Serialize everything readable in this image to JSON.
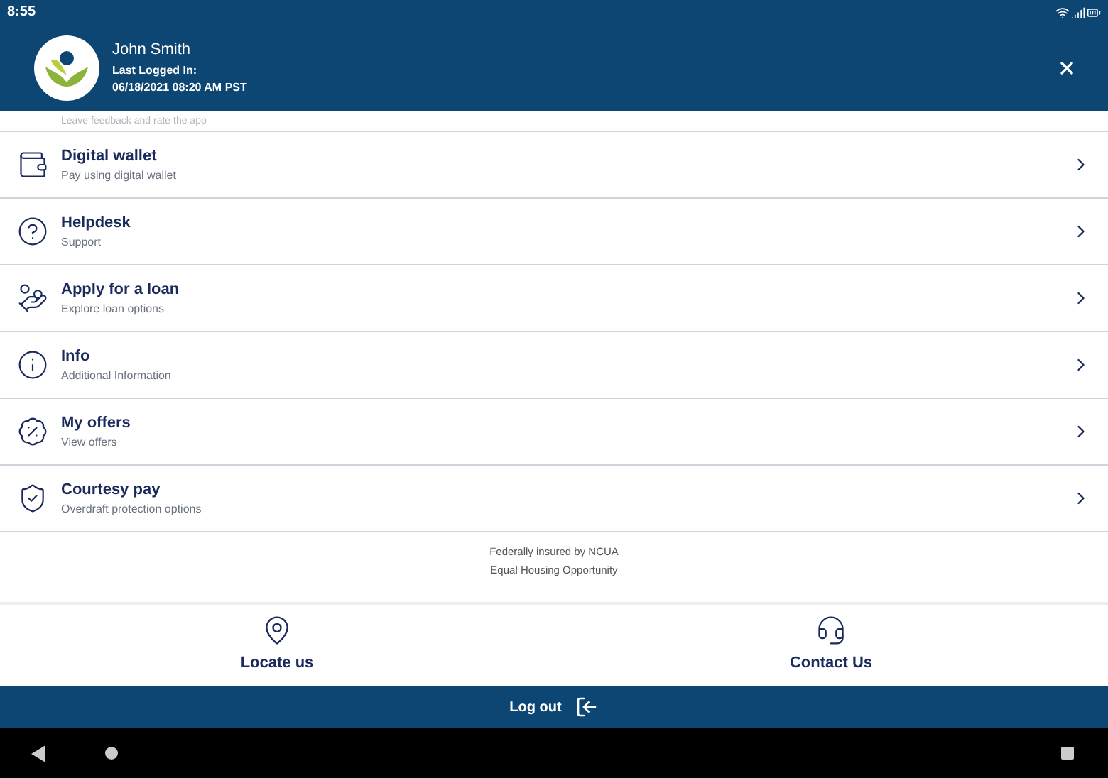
{
  "status_bar": {
    "time": "8:55"
  },
  "header": {
    "name": "John Smith",
    "last_login_label": "Last Logged In:",
    "last_login": "06/18/2021 08:20 AM PST"
  },
  "partial_item": {
    "subtitle": "Leave feedback and rate the app"
  },
  "menu_items": [
    {
      "kind": "wallet",
      "title": "Digital wallet",
      "subtitle": "Pay using digital wallet"
    },
    {
      "kind": "help",
      "title": "Helpdesk",
      "subtitle": "Support"
    },
    {
      "kind": "loan",
      "title": "Apply for a loan",
      "subtitle": "Explore loan options"
    },
    {
      "kind": "info",
      "title": "Info",
      "subtitle": "Additional Information"
    },
    {
      "kind": "offers",
      "title": "My offers",
      "subtitle": "View offers"
    },
    {
      "kind": "shield",
      "title": "Courtesy pay",
      "subtitle": "Overdraft protection options"
    }
  ],
  "footer_notes": [
    "Federally insured by NCUA",
    "Equal Housing Opportunity"
  ],
  "bottom_nav": [
    {
      "kind": "locate",
      "label": "Locate us"
    },
    {
      "kind": "contact",
      "label": "Contact Us"
    }
  ],
  "logout": {
    "label": "Log out"
  }
}
